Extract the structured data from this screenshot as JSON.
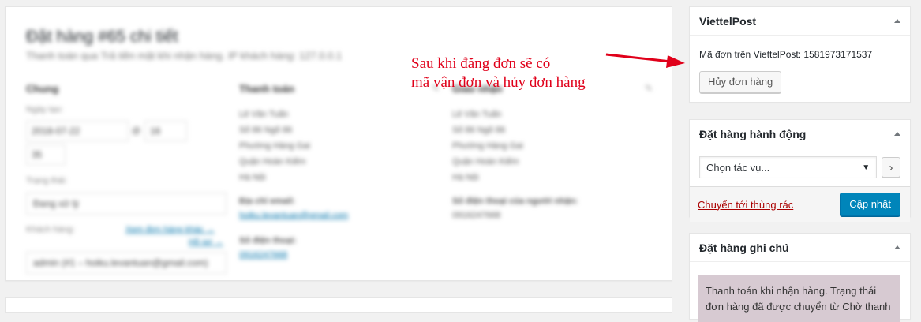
{
  "main": {
    "title": "Đặt hàng #65 chi tiết",
    "subtitle": "Thanh toán qua Trả tiền mặt khi nhận hàng. IP khách hàng: 127.0.0.1",
    "general": {
      "heading": "Chung",
      "date_label": "Ngày tạo:",
      "date_value": "2018-07-22",
      "at_label": "@",
      "hour_value": "16",
      "minute_value": "35",
      "status_label": "Trạng thái:",
      "status_value": "Đang xử lý",
      "customer_label": "Khách hàng:",
      "customer_link_1": "Xem đơn hàng khác →",
      "customer_link_2": "Hồ sơ →",
      "customer_value": "admin (#1 – hoiku.levantuan@gmail.com)"
    },
    "billing": {
      "heading": "Thanh toán",
      "lines": [
        "Lê Văn Tuấn",
        "Số 86 Ngõ 86",
        "Phường Hàng Gai",
        "Quận Hoàn Kiếm",
        "Hà Nội"
      ],
      "email_label": "Địa chỉ email:",
      "email_value": "hoiku.levantuan@gmail.com",
      "phone_label": "Số điện thoại:",
      "phone_value": "0916247668"
    },
    "shipping": {
      "heading": "Giao nhận",
      "lines": [
        "Lê Văn Tuấn",
        "Số 86 Ngõ 86",
        "Phường Hàng Gai",
        "Quận Hoàn Kiếm",
        "Hà Nội"
      ],
      "phone_label": "Số điện thoại của người nhận:",
      "phone_value": "0916247668"
    }
  },
  "annotation": {
    "line1": "Sau khi đăng đơn sẽ có",
    "line2": "mã vận đơn và hủy đơn hàng"
  },
  "viettelpost": {
    "title": "ViettelPost",
    "code_label": "Mã đơn trên ViettelPost:",
    "code_value": "1581973171537",
    "cancel_button": "Hủy đơn hàng"
  },
  "order_actions": {
    "title": "Đặt hàng hành động",
    "select_value": "Chọn tác vụ...",
    "go_button": "›",
    "trash_link": "Chuyển tới thùng rác",
    "update_button": "Cập nhật"
  },
  "order_notes": {
    "title": "Đặt hàng ghi chú",
    "note_text": "Thanh toán khi nhận hàng. Trạng thái đơn hàng đã được chuyển từ Chờ thanh"
  },
  "colors": {
    "annotation_red": "#e0001a",
    "primary_blue": "#0085ba",
    "trash_red": "#a00",
    "note_bg": "#d7cad2"
  }
}
